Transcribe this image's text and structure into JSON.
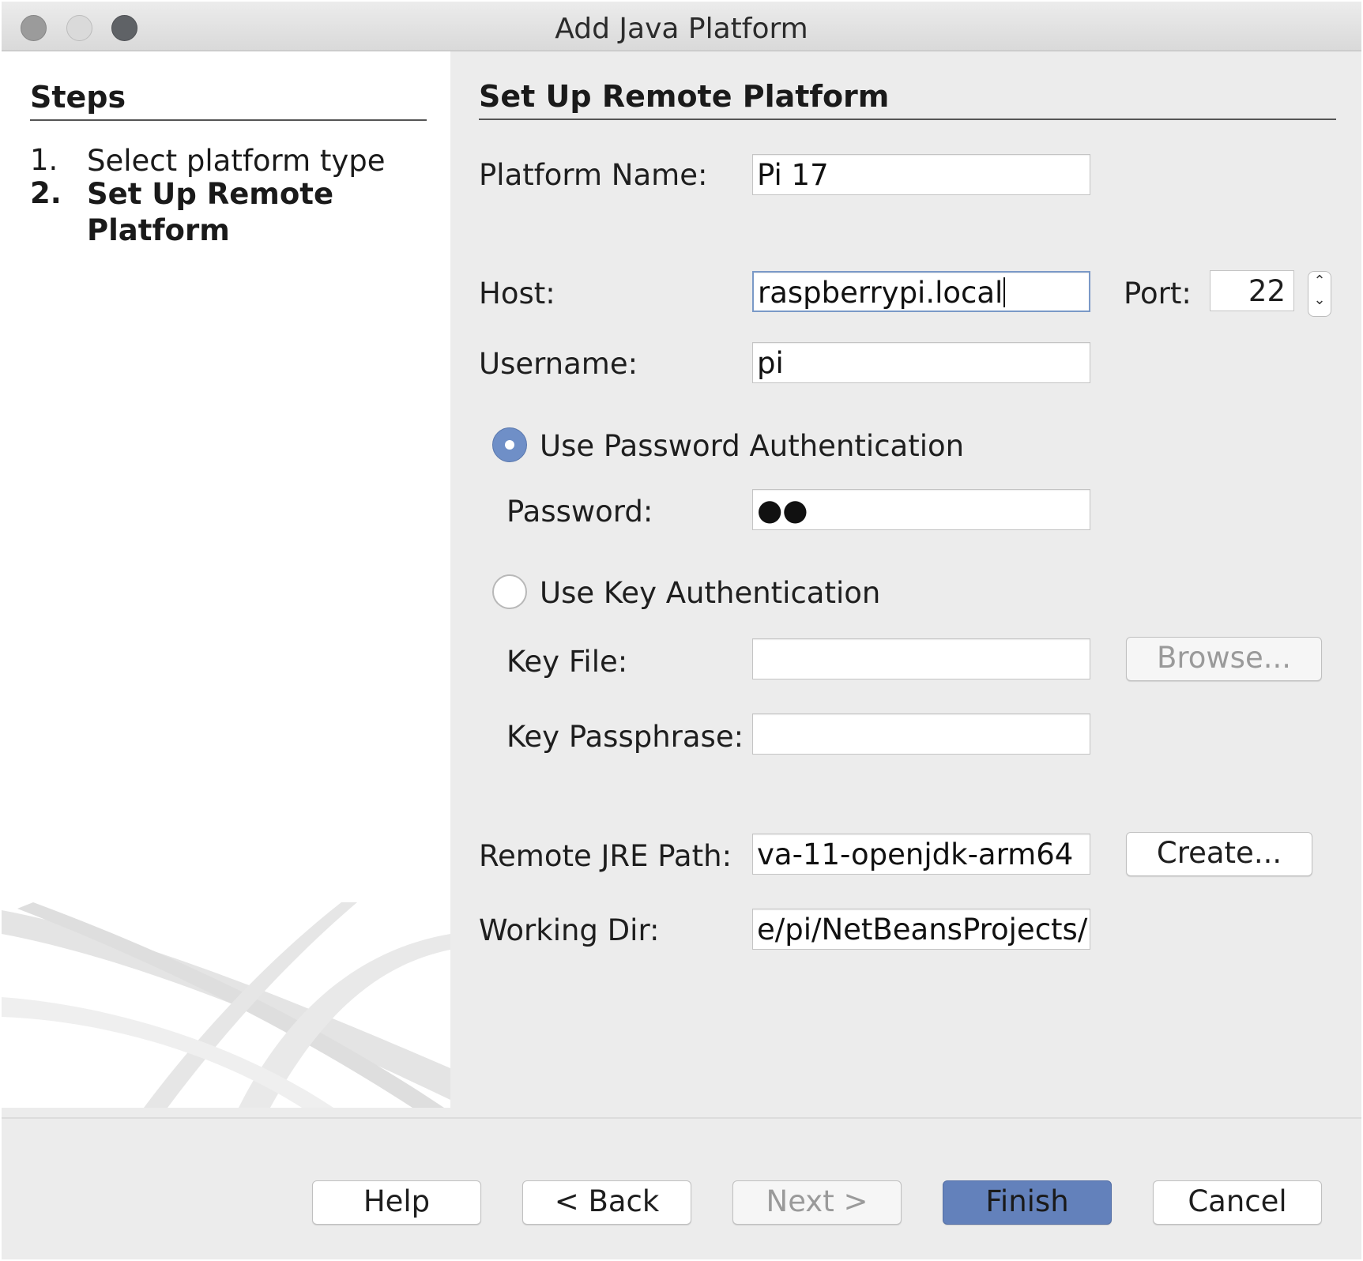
{
  "window": {
    "title": "Add Java Platform"
  },
  "steps": {
    "title": "Steps",
    "items": [
      {
        "number": "1.",
        "label": "Select platform type",
        "current": false
      },
      {
        "number": "2.",
        "label": "Set Up Remote Platform",
        "current": true
      }
    ]
  },
  "form": {
    "section_title": "Set Up Remote Platform",
    "platform_name": {
      "label": "Platform Name:",
      "value": "Pi 17"
    },
    "host": {
      "label": "Host:",
      "value": "raspberrypi.local"
    },
    "port": {
      "label": "Port:",
      "value": "22",
      "spinner_up": "⌃",
      "spinner_down": "⌄"
    },
    "username": {
      "label": "Username:",
      "value": "pi"
    },
    "password_auth": {
      "label": "Use Password Authentication",
      "selected": true
    },
    "password": {
      "label": "Password:",
      "value": "●●"
    },
    "key_auth": {
      "label": "Use Key Authentication",
      "selected": false
    },
    "key_file": {
      "label": "Key File:",
      "value": "",
      "button": "Browse..."
    },
    "key_passphrase": {
      "label": "Key Passphrase:",
      "value": ""
    },
    "remote_jre_path": {
      "label": "Remote JRE Path:",
      "value": "va-11-openjdk-arm64",
      "button": "Create..."
    },
    "working_dir": {
      "label": "Working Dir:",
      "value": "e/pi/NetBeansProjects/"
    }
  },
  "footer": {
    "help": "Help",
    "back": "< Back",
    "next": "Next >",
    "finish": "Finish",
    "cancel": "Cancel"
  },
  "colors": {
    "accent": "#6381bb",
    "radio_selected": "#6f8fc7",
    "window_bg": "#ececec"
  }
}
